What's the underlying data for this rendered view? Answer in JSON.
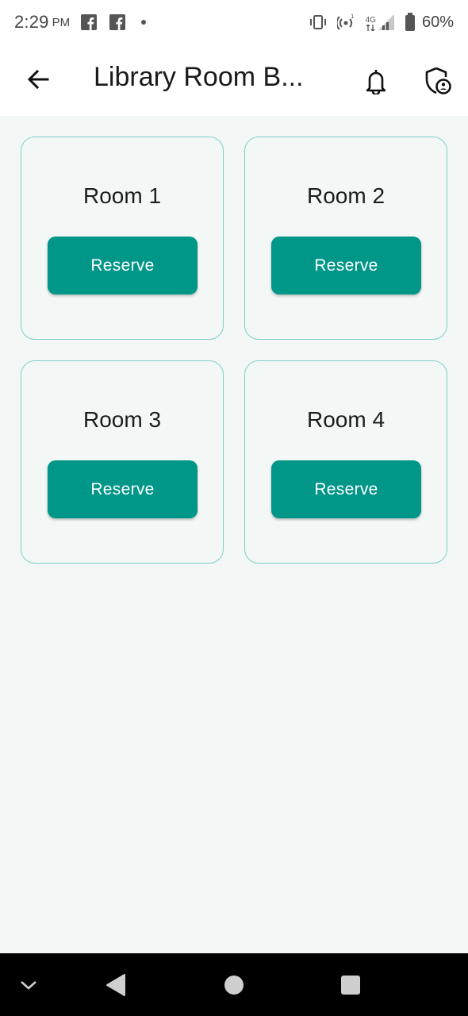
{
  "status_bar": {
    "time": "2:29",
    "ampm": "PM",
    "notification_icons": [
      "facebook-icon",
      "facebook-icon"
    ],
    "network_label": "4G",
    "battery_percent": "60%"
  },
  "app_bar": {
    "title": "Library Room B..."
  },
  "rooms": [
    {
      "name": "Room 1",
      "button_label": "Reserve"
    },
    {
      "name": "Room 2",
      "button_label": "Reserve"
    },
    {
      "name": "Room 3",
      "button_label": "Reserve"
    },
    {
      "name": "Room 4",
      "button_label": "Reserve"
    }
  ],
  "colors": {
    "accent": "#009688",
    "card_border": "#7fcfc8",
    "background": "#f3f8f7"
  }
}
